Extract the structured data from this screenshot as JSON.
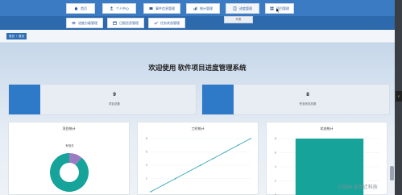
{
  "nav": {
    "row1": [
      {
        "label": "首页",
        "icon": "home-icon",
        "active": false
      },
      {
        "label": "个人中心",
        "icon": "user-icon",
        "active": false
      },
      {
        "label": "事件信息管理",
        "icon": "folder-icon",
        "active": false
      },
      {
        "label": "统计管理",
        "icon": "chart-icon",
        "active": false
      },
      {
        "label": "进度管理",
        "icon": "doc-icon",
        "active": true
      },
      {
        "label": "项目管理",
        "icon": "grid-icon",
        "active": false
      }
    ],
    "row2": [
      {
        "label": "进度分级管理",
        "icon": "list-icon"
      },
      {
        "label": "日报信息管理",
        "icon": "calendar-icon"
      },
      {
        "label": "任务状态管理",
        "icon": "tasks-icon"
      }
    ],
    "dropdown_item": "列表"
  },
  "breadcrumb": {
    "home": "首页",
    "current": "首页"
  },
  "welcome_title": "欢迎使用 软件项目进度管理系统",
  "stats": [
    {
      "value": "9",
      "label": "项目总数"
    },
    {
      "value": "8",
      "label": "任务状态总数"
    }
  ],
  "panels": [
    {
      "title": "项目统计"
    },
    {
      "title": "工时统计"
    },
    {
      "title": "状态统计"
    }
  ],
  "chart_data": [
    {
      "type": "pie",
      "title": "项目统计",
      "slices": [
        {
          "name": "有相关",
          "value": 1,
          "color": "#9b7cc4"
        },
        {
          "name": "",
          "value": 8,
          "color": "#15a39a"
        }
      ]
    },
    {
      "type": "line",
      "title": "工时统计",
      "x": [
        0,
        1,
        2,
        3,
        4,
        5,
        6,
        7,
        8
      ],
      "y": [
        0,
        1,
        2,
        3,
        4,
        5,
        6,
        7,
        8
      ],
      "ylim": [
        0,
        8
      ],
      "yticks": [
        "8",
        "6",
        "4",
        "2"
      ],
      "color": "#2aa3b3"
    },
    {
      "type": "bar",
      "title": "状态统计",
      "values": [
        8
      ],
      "ylim": [
        0,
        8
      ],
      "yticks": [
        "8",
        "6",
        "4",
        "2",
        "0"
      ],
      "color": "#15a39a"
    }
  ],
  "watermark": "CSDN @世迁科技"
}
